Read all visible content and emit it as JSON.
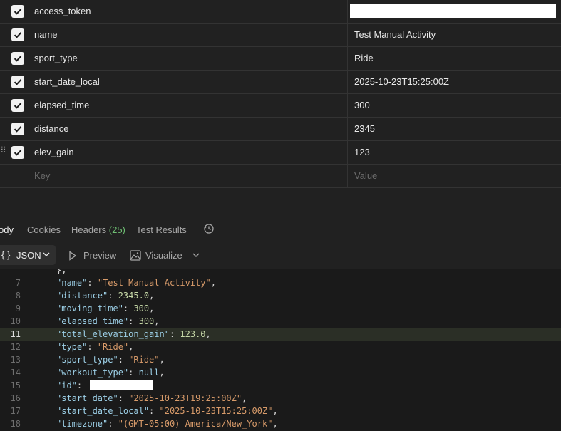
{
  "params": {
    "rows": [
      {
        "key": "access_token",
        "value": "",
        "checked": true,
        "redacted": true
      },
      {
        "key": "name",
        "value": "Test Manual Activity",
        "checked": true
      },
      {
        "key": "sport_type",
        "value": "Ride",
        "checked": true
      },
      {
        "key": "start_date_local",
        "value": "2025-10-23T15:25:00Z",
        "checked": true
      },
      {
        "key": "elapsed_time",
        "value": "300",
        "checked": true
      },
      {
        "key": "distance",
        "value": "2345",
        "checked": true
      },
      {
        "key": "elev_gain",
        "value": "123",
        "checked": true,
        "drag_handle": true
      }
    ],
    "placeholder": {
      "key": "Key",
      "value": "Value"
    }
  },
  "response_tabs": {
    "body": "ody",
    "cookies": "Cookies",
    "headers": "Headers",
    "headers_count": "(25)",
    "test_results": "Test Results"
  },
  "toolbar": {
    "format_icon": "{ }",
    "format_label": "JSON",
    "preview_label": "Preview",
    "visualize_label": "Visualize"
  },
  "editor": {
    "highlighted_line": 11,
    "lines": [
      {
        "num": "",
        "text": "},"
      },
      {
        "num": "7",
        "key": "name",
        "value": "\"Test Manual Activity\"",
        "vtype": "s"
      },
      {
        "num": "8",
        "key": "distance",
        "value": "2345.0",
        "vtype": "n"
      },
      {
        "num": "9",
        "key": "moving_time",
        "value": "300",
        "vtype": "n"
      },
      {
        "num": "10",
        "key": "elapsed_time",
        "value": "300",
        "vtype": "n"
      },
      {
        "num": "11",
        "key": "total_elevation_gain",
        "value": "123.0",
        "vtype": "n"
      },
      {
        "num": "12",
        "key": "type",
        "value": "\"Ride\"",
        "vtype": "s"
      },
      {
        "num": "13",
        "key": "sport_type",
        "value": "\"Ride\"",
        "vtype": "s"
      },
      {
        "num": "14",
        "key": "workout_type",
        "value": "null",
        "vtype": "kw"
      },
      {
        "num": "15",
        "key": "id",
        "value": "",
        "vtype": "redacted"
      },
      {
        "num": "16",
        "key": "start_date",
        "value": "\"2025-10-23T19:25:00Z\"",
        "vtype": "s"
      },
      {
        "num": "17",
        "key": "start_date_local",
        "value": "\"2025-10-23T15:25:00Z\"",
        "vtype": "s"
      },
      {
        "num": "18",
        "key": "timezone",
        "value": "\"(GMT-05:00) America/New_York\"",
        "vtype": "s"
      }
    ]
  },
  "colors": {
    "background": "#212121",
    "editor_bg": "#1a1a1a",
    "json_key": "#9ccfe6",
    "json_string": "#d89b6a",
    "json_number": "#c7d9a8",
    "headers_count": "#6fbf73"
  }
}
